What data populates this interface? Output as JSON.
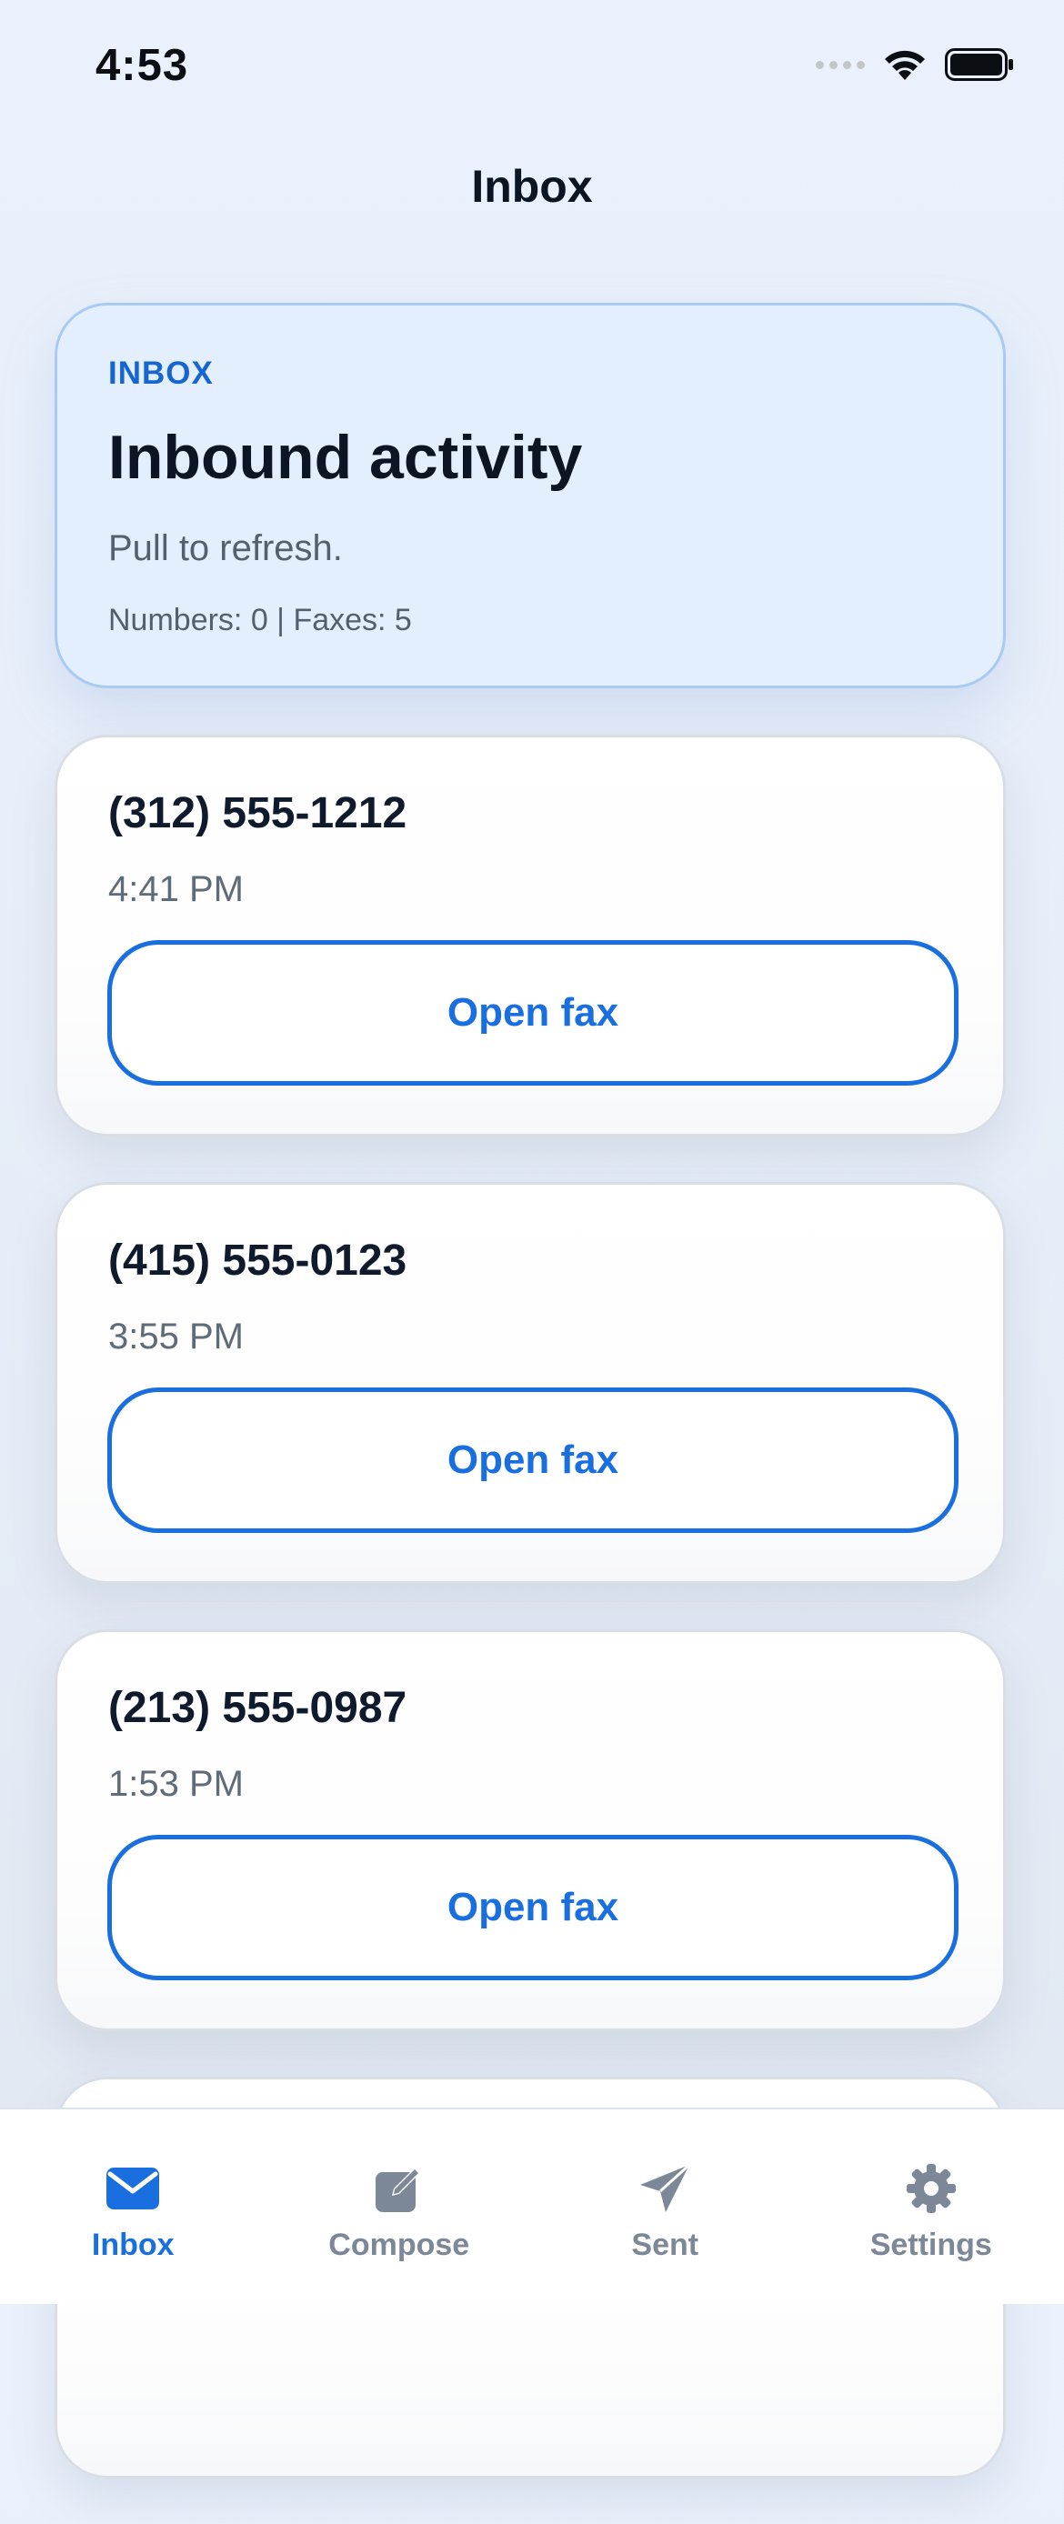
{
  "status_bar": {
    "time": "4:53"
  },
  "nav": {
    "title": "Inbox"
  },
  "hero": {
    "kicker": "INBOX",
    "title": "Inbound activity",
    "subtitle": "Pull to refresh.",
    "stats": "Numbers: 0 | Faxes: 5"
  },
  "faxes": [
    {
      "number": "(312) 555-1212",
      "time": "4:41 PM",
      "action_label": "Open fax"
    },
    {
      "number": "(415) 555-0123",
      "time": "3:55 PM",
      "action_label": "Open fax"
    },
    {
      "number": "(213) 555-0987",
      "time": "1:53 PM",
      "action_label": "Open fax"
    }
  ],
  "tab_bar": {
    "tabs": [
      {
        "label": "Inbox",
        "icon": "envelope-icon",
        "active": true
      },
      {
        "label": "Compose",
        "icon": "compose-icon",
        "active": false
      },
      {
        "label": "Sent",
        "icon": "paper-plane-icon",
        "active": false
      },
      {
        "label": "Settings",
        "icon": "gear-icon",
        "active": false
      }
    ]
  },
  "colors": {
    "accent": "#1a6fe0",
    "hero_background": "#e4effd",
    "hero_border": "#a9cbf3",
    "tab_inactive": "#7c8797"
  }
}
